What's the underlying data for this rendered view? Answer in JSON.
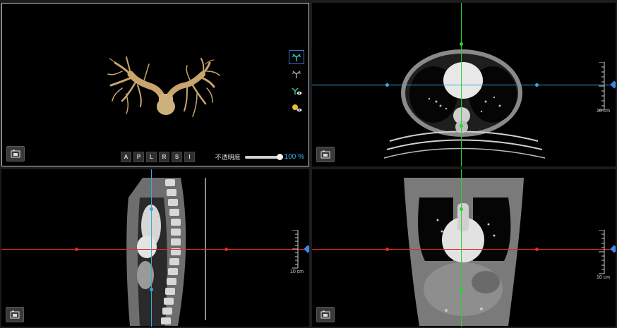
{
  "viewer": {
    "orientation_buttons": [
      "A",
      "P",
      "L",
      "R",
      "S",
      "I"
    ],
    "opacity": {
      "label": "不透明度",
      "value_text": "100 %",
      "fraction": 1.0
    },
    "ruler_label": "10 cm",
    "tools": [
      {
        "name": "vessel-tree-icon",
        "active": true
      },
      {
        "name": "vessel-gray-icon",
        "active": false
      },
      {
        "name": "vessel-eye-icon",
        "active": false
      },
      {
        "name": "bone-eye-icon",
        "active": false
      }
    ],
    "colors": {
      "axial_line": "#39a9d8",
      "sagittal_line": "#2ad42a",
      "coronal_line": "#e02a2a",
      "accent": "#3ab3e8",
      "vessel": "#c2a06a"
    }
  }
}
